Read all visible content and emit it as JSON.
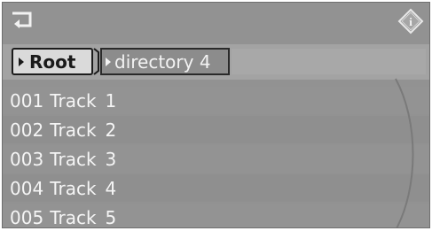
{
  "header": {
    "back_icon": "back-arrow-icon",
    "info_icon": "info-diamond-icon",
    "info_label": "i"
  },
  "breadcrumb": {
    "root_label": "Root",
    "directory_label": "directory 4"
  },
  "tracks": [
    {
      "number": "001",
      "title": "Track",
      "index": "1"
    },
    {
      "number": "002",
      "title": "Track",
      "index": "2"
    },
    {
      "number": "003",
      "title": "Track",
      "index": "3"
    },
    {
      "number": "004",
      "title": "Track",
      "index": "4"
    },
    {
      "number": "005",
      "title": "Track",
      "index": "5"
    }
  ],
  "colors": {
    "background": "#929292",
    "selected_bg": "#dadada",
    "text": "#f5f5f5"
  }
}
